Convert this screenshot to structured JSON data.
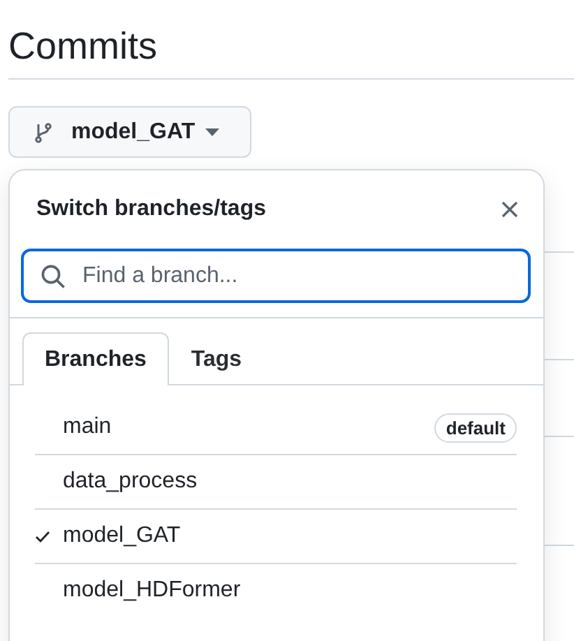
{
  "page_title": "Commits",
  "branch_button": {
    "label": "model_GAT"
  },
  "dropdown": {
    "title": "Switch branches/tags",
    "search": {
      "placeholder": "Find a branch..."
    },
    "tabs": [
      {
        "label": "Branches",
        "selected": true
      },
      {
        "label": "Tags",
        "selected": false
      }
    ],
    "branches": [
      {
        "name": "main",
        "checked": false,
        "badge": "default"
      },
      {
        "name": "data_process",
        "checked": false
      },
      {
        "name": "model_GAT",
        "checked": true
      },
      {
        "name": "model_HDFormer",
        "checked": false
      }
    ]
  }
}
